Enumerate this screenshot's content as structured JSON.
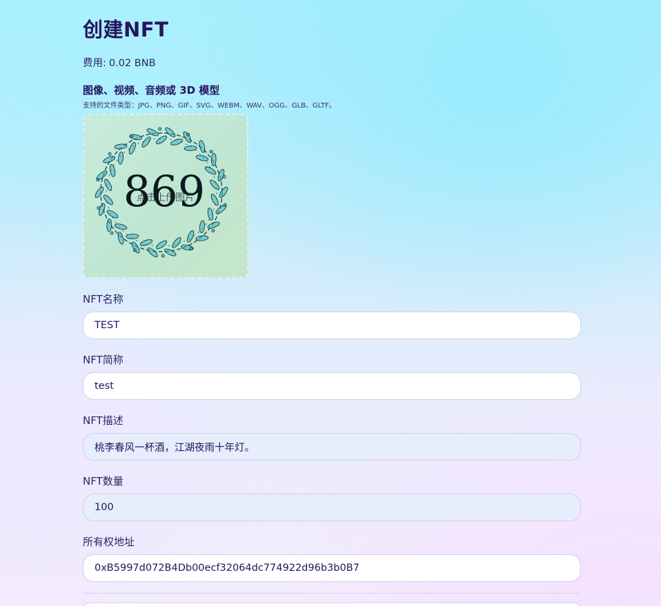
{
  "page": {
    "title": "创建NFT",
    "fee_label": "费用:",
    "fee_value": "0.02 BNB"
  },
  "media": {
    "title": "图像、视频、音频或 3D 模型",
    "supported_types": "支持的文件类型：JPG、PNG、GIF、SVG、WEBM、WAV、OGG、GLB、GLTF。",
    "upload_text": "点击上传图片",
    "preview_number": "869"
  },
  "fields": {
    "name": {
      "label": "NFT名称",
      "value": "TEST"
    },
    "symbol": {
      "label": "NFT简称",
      "value": "test"
    },
    "description": {
      "label": "NFT描述",
      "value": "桃李春风一杯酒，江湖夜雨十年灯。"
    },
    "quantity": {
      "label": "NFT数量",
      "value": "100"
    },
    "owner": {
      "label": "所有权地址",
      "value": "0xB5997d072B4Db00ecf32064dc774922d96b3b0B7"
    }
  },
  "colors": {
    "title": "#23155e",
    "input_border": "#cfd0ec",
    "input_shaded_bg": "#e6edfb"
  }
}
